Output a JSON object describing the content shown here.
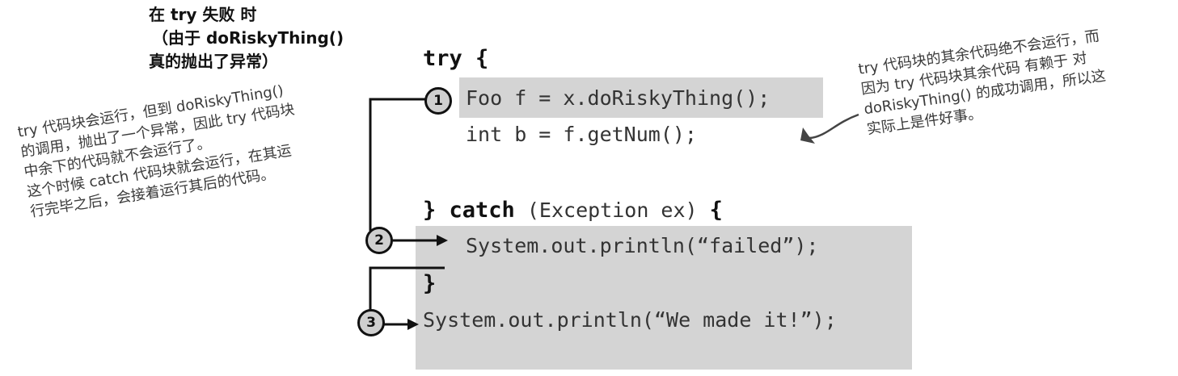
{
  "top_note": {
    "line1": "在 try 失败 时",
    "line2": "（由于 doRiskyThing()",
    "line3": "真的抛出了异常）"
  },
  "code": {
    "try_keyword": "try",
    "try_brace": " {",
    "line_foo": "Foo f = x.doRiskyThing();",
    "line_int": "int b = f.getNum();",
    "close_brace": "}",
    "catch_keyword": "catch",
    "catch_args": " (Exception ex) ",
    "catch_brace": "{",
    "line_failed": "System.out.println(“failed”);",
    "catch_close": "}",
    "line_made": "System.out.println(“We made it!”);"
  },
  "steps": {
    "one": "1",
    "two": "2",
    "three": "3"
  },
  "left_note": {
    "line1": "try 代码块会运行，但到 doRiskyThing()",
    "line2": "的调用，抛出了一个异常，因此 try 代码块",
    "line3": "中余下的代码就不会运行了。",
    "line4": "这个时候 catch 代码块就会运行，在其运",
    "line5": "行完毕之后，会接着运行其后的代码。"
  },
  "right_note": {
    "line1": "try 代码块的其余代码绝不会运行，而",
    "line2": "因为 try 代码块其余代码 有赖于 对",
    "line3": "doRiskyThing() 的成功调用，所以这",
    "line4": "实际上是件好事。"
  },
  "colors": {
    "highlight": "#d4d4d4",
    "line": "#111111",
    "circle_fill": "#cfcfcf"
  }
}
